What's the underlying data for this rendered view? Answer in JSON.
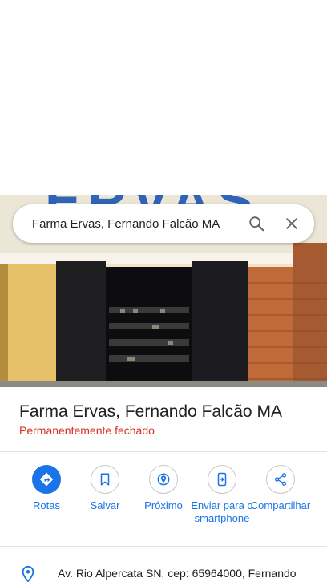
{
  "search": {
    "query": "Farma Ervas, Fernando Falcão MA"
  },
  "photo": {
    "sign_text": "ERVAS"
  },
  "place": {
    "title": "Farma Ervas, Fernando Falcão MA",
    "status": "Permanentemente fechado"
  },
  "actions": [
    {
      "label": "Rotas",
      "icon": "directions-icon"
    },
    {
      "label": "Salvar",
      "icon": "bookmark-icon"
    },
    {
      "label": "Próximo",
      "icon": "nearby-icon"
    },
    {
      "label": "Enviar para o smartphone",
      "icon": "send-to-phone-icon"
    },
    {
      "label": "Compartilhar",
      "icon": "share-icon"
    }
  ],
  "details": {
    "address": "Av. Rio Alpercata SN, cep: 65964000, Fernando"
  },
  "colors": {
    "accent": "#1a73e8",
    "status_closed": "#d93025"
  }
}
